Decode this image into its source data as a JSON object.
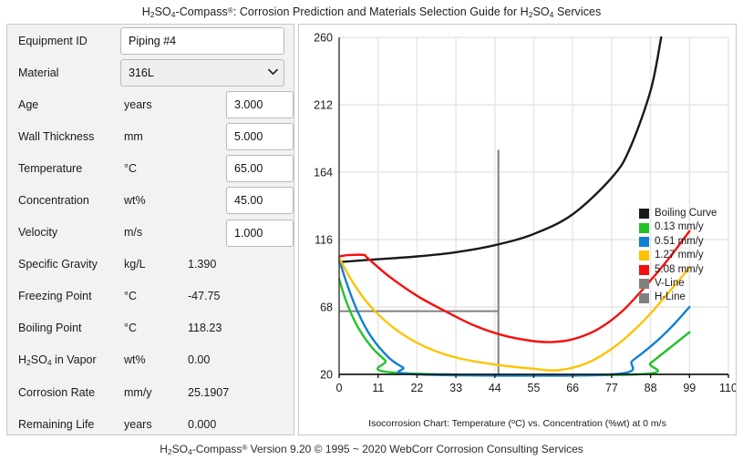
{
  "app": {
    "title_html_parts": {
      "pre": "H",
      "sub1": "2",
      "mid1": "SO",
      "sub2": "4",
      "mid2": "-Compass",
      "sup": "®",
      "tail1": ": Corrosion Prediction and Materials Selection Guide for H",
      "sub3": "2",
      "tail2": "SO",
      "sub4": "4",
      "tail3": " Services"
    },
    "title_text": "H2SO4-Compass®: Corrosion Prediction and Materials Selection Guide for H2SO4 Services"
  },
  "form": {
    "equipment_id": {
      "label": "Equipment ID",
      "value": "Piping #4",
      "placeholder": "Equipment ID"
    },
    "material": {
      "label": "Material",
      "value": "316L",
      "options": [
        "316L"
      ]
    },
    "age": {
      "label": "Age",
      "unit": "years",
      "value": "3.000"
    },
    "wall_thickness": {
      "label": "Wall Thickness",
      "unit": "mm",
      "value": "5.000"
    },
    "temperature": {
      "label": "Temperature",
      "unit": "°C",
      "value": "65.00"
    },
    "concentration": {
      "label": "Concentration",
      "unit": "wt%",
      "value": "45.00"
    },
    "velocity": {
      "label": "Velocity",
      "unit": "m/s",
      "value": "1.000"
    },
    "specific_gravity": {
      "label": "Specific Gravity",
      "unit": "kg/L",
      "value": "1.390"
    },
    "freezing_point": {
      "label": "Freezing Point",
      "unit": "°C",
      "value": "-47.75"
    },
    "boiling_point": {
      "label": "Boiling Point",
      "unit": "°C",
      "value": "118.23"
    },
    "h2so4_in_vapor": {
      "label_pre": "H",
      "label_sub1": "2",
      "label_mid": "SO",
      "label_sub2": "4",
      "label_tail": " in Vapor",
      "label": "H2SO4 in Vapor",
      "unit": "wt%",
      "value": "0.00"
    },
    "corrosion_rate": {
      "label": "Corrosion Rate",
      "unit": "mm/y",
      "value": "25.1907"
    },
    "remaining_life": {
      "label": "Remaining Life",
      "unit": "years",
      "value": "0.000"
    }
  },
  "chart_caption": {
    "pre": "Isocorrosion Chart: Temperature (",
    "sup1": "o",
    "mid": "C) vs. Concentration (%wt) at 0 m/s",
    "text": "Isocorrosion Chart: Temperature (oC) vs. Concentration (%wt) at 0 m/s"
  },
  "footer": {
    "pre": "H",
    "sub1": "2",
    "mid1": "SO",
    "sub2": "4",
    "mid2": "-Compass",
    "sup": "®",
    "tail": " Version 9.20 © 1995 ~ 2020  WebCorr Corrosion Consulting Services",
    "text": "H2SO4-Compass® Version 9.20 © 1995 ~ 2020  WebCorr Corrosion Consulting Services"
  },
  "legend": {
    "items": [
      {
        "label": "Boiling Curve",
        "color": "#1a1a1a"
      },
      {
        "label": "0.13 mm/y",
        "color": "#22c32a"
      },
      {
        "label": "0.51 mm/y",
        "color": "#0f7fd4"
      },
      {
        "label": "1.27 mm/y",
        "color": "#ffc200"
      },
      {
        "label": "5.08 mm/y",
        "color": "#f50f0f"
      },
      {
        "label": "V-Line",
        "color": "#808080"
      },
      {
        "label": "H-Line",
        "color": "#808080"
      }
    ]
  },
  "chart_data": {
    "type": "line",
    "title": "Isocorrosion Chart: Temperature (oC) vs. Concentration (%wt) at 0 m/s",
    "xlabel": "Concentration (%wt)",
    "ylabel": "Temperature (oC)",
    "xlim": [
      0,
      110
    ],
    "ylim": [
      20,
      260
    ],
    "xticks": [
      0,
      11,
      22,
      33,
      44,
      55,
      66,
      77,
      88,
      99,
      110
    ],
    "yticks": [
      20,
      68,
      116,
      164,
      212,
      260
    ],
    "grid": true,
    "legend_position": "right-inside",
    "annotations": [
      {
        "name": "V-Line",
        "type": "vline",
        "x": 45,
        "y_from": 20,
        "y_to": 180,
        "color": "#808080"
      },
      {
        "name": "H-Line",
        "type": "hline",
        "y": 65,
        "x_from": 0,
        "x_to": 45,
        "color": "#808080"
      }
    ],
    "series": [
      {
        "name": "Boiling Curve",
        "color": "#1a1a1a",
        "x": [
          0,
          11,
          22,
          33,
          44,
          55,
          66,
          77,
          82,
          88,
          91
        ],
        "y": [
          100,
          102,
          104,
          107,
          112,
          120,
          134,
          160,
          180,
          222,
          260
        ]
      },
      {
        "name": "0.13 mm/y",
        "color": "#22c32a",
        "x": [
          0,
          2,
          5,
          9,
          13,
          17,
          84,
          88,
          93,
          99
        ],
        "y": [
          88,
          72,
          55,
          40,
          30,
          21,
          20,
          28,
          38,
          50
        ]
      },
      {
        "name": "0.51 mm/y",
        "color": "#0f7fd4",
        "x": [
          0,
          2,
          5,
          9,
          14,
          18,
          22,
          77,
          83,
          89,
          94,
          99
        ],
        "y": [
          102,
          86,
          66,
          47,
          32,
          25,
          20,
          20,
          30,
          42,
          54,
          68
        ]
      },
      {
        "name": "1.27 mm/y",
        "color": "#ffc200",
        "x": [
          0,
          4,
          9,
          16,
          24,
          33,
          44,
          55,
          62,
          70,
          78,
          86,
          93,
          99
        ],
        "y": [
          103,
          85,
          68,
          52,
          40,
          32,
          27,
          24,
          23,
          28,
          40,
          58,
          78,
          96
        ]
      },
      {
        "name": "5.08 mm/y",
        "color": "#f50f0f",
        "x": [
          0,
          3,
          7,
          8,
          14,
          22,
          30,
          38,
          46,
          54,
          60,
          66,
          73,
          80,
          87,
          93,
          99
        ],
        "y": [
          104,
          105,
          105,
          103,
          90,
          76,
          65,
          55,
          48,
          44,
          43,
          45,
          52,
          65,
          84,
          102,
          122
        ]
      }
    ]
  }
}
